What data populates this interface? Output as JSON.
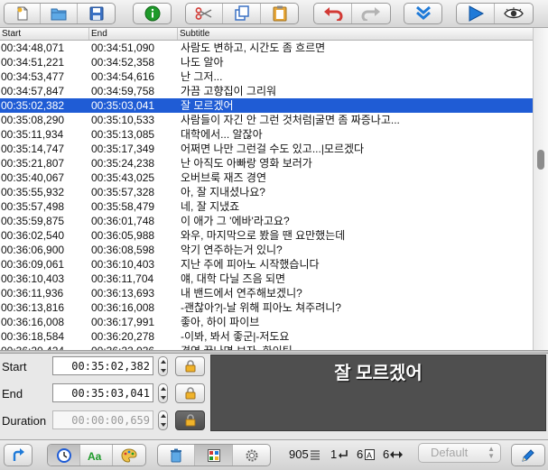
{
  "table": {
    "headers": {
      "start": "Start",
      "end": "End",
      "subtitle": "Subtitle"
    },
    "rows": [
      {
        "start": "00:34:48,071",
        "end": "00:34:51,090",
        "text": "사람도 변하고, 시간도 좀 흐르면"
      },
      {
        "start": "00:34:51,221",
        "end": "00:34:52,358",
        "text": "나도 알아"
      },
      {
        "start": "00:34:53,477",
        "end": "00:34:54,616",
        "text": "난 그저..."
      },
      {
        "start": "00:34:57,847",
        "end": "00:34:59,758",
        "text": "가끔 고향집이 그리워"
      },
      {
        "start": "00:35:02,382",
        "end": "00:35:03,041",
        "text": "잘 모르겠어"
      },
      {
        "start": "00:35:08,290",
        "end": "00:35:10,533",
        "text": "사람들이 자긴 안 그런 것처럼|굴면 좀 짜증나고..."
      },
      {
        "start": "00:35:11,934",
        "end": "00:35:13,085",
        "text": "대학에서... 알잖아"
      },
      {
        "start": "00:35:14,747",
        "end": "00:35:17,349",
        "text": "어쩌면 나만 그런걸 수도 있고...|모르겠다"
      },
      {
        "start": "00:35:21,807",
        "end": "00:35:24,238",
        "text": "난 아직도 아빠랑 영화 보러가"
      },
      {
        "start": "00:35:40,067",
        "end": "00:35:43,025",
        "text": "오버브룩 재즈 경연"
      },
      {
        "start": "00:35:55,932",
        "end": "00:35:57,328",
        "text": "아, 잘 지내셨나요?"
      },
      {
        "start": "00:35:57,498",
        "end": "00:35:58,479",
        "text": "네, 잘 지냈죠"
      },
      {
        "start": "00:35:59,875",
        "end": "00:36:01,748",
        "text": "이 애가 그 '에바'라고요?"
      },
      {
        "start": "00:36:02,540",
        "end": "00:36:05,988",
        "text": "와우, 마지막으로 봤을 땐 요만했는데"
      },
      {
        "start": "00:36:06,900",
        "end": "00:36:08,598",
        "text": "악기 연주하는거 있니?"
      },
      {
        "start": "00:36:09,061",
        "end": "00:36:10,403",
        "text": "지난 주에 피아노 시작했습니다"
      },
      {
        "start": "00:36:10,403",
        "end": "00:36:11,704",
        "text": "얘, 대학 다닐 즈음 되면"
      },
      {
        "start": "00:36:11,936",
        "end": "00:36:13,693",
        "text": "내 밴드에서 연주해보겠니?"
      },
      {
        "start": "00:36:13,816",
        "end": "00:36:16,008",
        "text": "-괜찮아?|-날 위해 피아노 쳐주려니?"
      },
      {
        "start": "00:36:16,008",
        "end": "00:36:17,991",
        "text": "좋아, 하이 파이브"
      },
      {
        "start": "00:36:18,584",
        "end": "00:36:20,278",
        "text": "-이봐, 봐서 좋군|-저도요"
      },
      {
        "start": "00:36:20,424",
        "end": "00:36:22,036",
        "text": "경연 끝나면 보자. 화이팅"
      }
    ],
    "selected_row_index": 4
  },
  "editor": {
    "start_label": "Start",
    "start_value": "00:35:02,382",
    "end_label": "End",
    "end_value": "00:35:03,041",
    "duration_label": "Duration",
    "duration_value": "00:00:00,659"
  },
  "preview": {
    "text": "잘 모르겠어"
  },
  "status": {
    "total": "905",
    "line": "1",
    "chars_a": "6",
    "chars_b": "6"
  },
  "style_select": {
    "value": "Default"
  },
  "icons": {
    "toolbar": [
      "new-document-icon",
      "open-folder-icon",
      "save-disk-icon",
      "info-icon",
      "cut-scissors-icon",
      "copy-icon",
      "paste-clipboard-icon",
      "undo-arrow-icon",
      "redo-arrow-icon",
      "merge-down-chevrons-icon",
      "play-icon",
      "eye-preview-icon"
    ],
    "bottom": [
      "link-arrow-icon",
      "clock-icon",
      "text-style-icon",
      "palette-icon",
      "trash-icon",
      "grid-icon",
      "gear-icon",
      "pencil-icon"
    ]
  },
  "colors": {
    "selection": "#1f5cd5",
    "preview_bg": "#4f4f4f",
    "accent_red": "#d23a35",
    "accent_blue": "#1f7ad8",
    "info_green": "#1e9a2a"
  }
}
